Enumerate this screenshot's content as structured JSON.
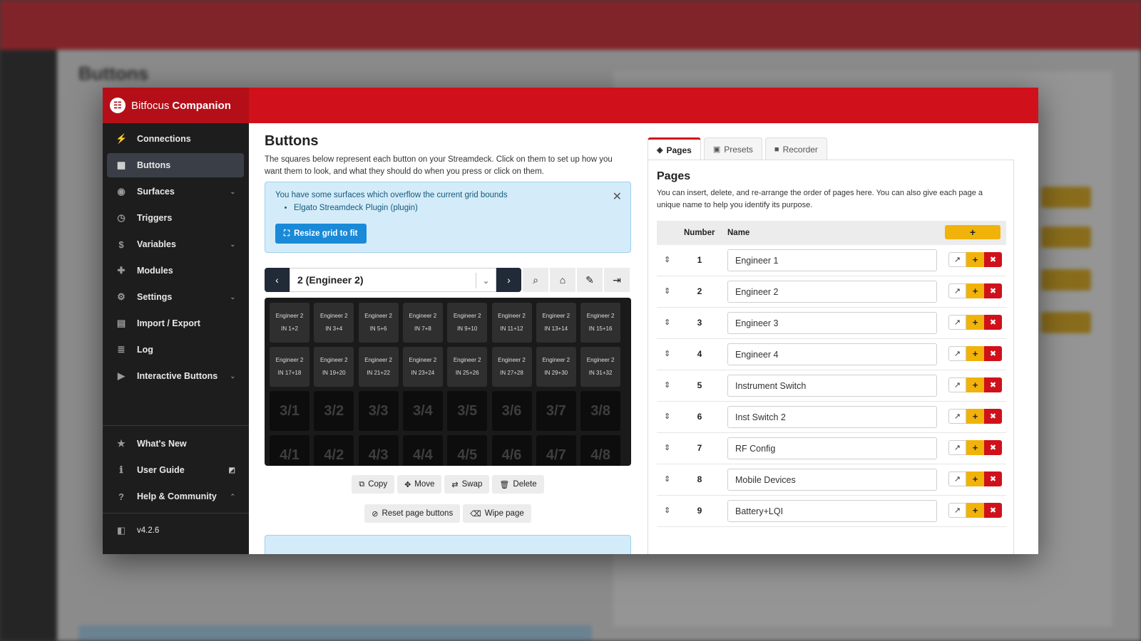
{
  "brand": {
    "logo_glyph": "☷",
    "name_light": "Bitfocus",
    "name_bold": "Companion"
  },
  "colors": {
    "header_red": "#d0111b",
    "sidebar_dark": "#1d1d1d",
    "primary_blue": "#1a8ad8",
    "warning_yellow": "#f1b30a",
    "danger_red": "#d0111b"
  },
  "background": {
    "title": "Buttons"
  },
  "sidebar": {
    "items": [
      {
        "label": "Connections",
        "icon": "plug-icon"
      },
      {
        "label": "Buttons",
        "icon": "grid-icon"
      },
      {
        "label": "Surfaces",
        "icon": "gamepad-icon"
      },
      {
        "label": "Triggers",
        "icon": "clock-icon"
      },
      {
        "label": "Variables",
        "icon": "dollar-icon"
      },
      {
        "label": "Modules",
        "icon": "puzzle-icon"
      },
      {
        "label": "Settings",
        "icon": "gear-icon"
      },
      {
        "label": "Import / Export",
        "icon": "file-import-icon"
      },
      {
        "label": "Log",
        "icon": "log-icon"
      },
      {
        "label": "Interactive Buttons",
        "icon": "play-icon"
      }
    ],
    "bottom": [
      {
        "label": "What's New",
        "icon": "star-icon"
      },
      {
        "label": "User Guide",
        "icon": "info-icon"
      },
      {
        "label": "Help & Community",
        "icon": "help-icon"
      }
    ],
    "version": "v4.2.6"
  },
  "main": {
    "title": "Buttons",
    "description": "The squares below represent each button on your Streamdeck. Click on them to set up how you want them to look, and what they should do when you press or click on them.",
    "alert": {
      "message": "You have some surfaces which overflow the current grid bounds",
      "item": "Elgato Streamdeck Plugin (plugin)",
      "button": "Resize grid to fit"
    },
    "page_select": "2 (Engineer 2)",
    "grid_row1": [
      "Engineer 2",
      "IN 1+2",
      "Engineer 2",
      "IN 3+4",
      "Engineer 2",
      "IN 5+6",
      "Engineer 2",
      "IN 7+8",
      "Engineer 2",
      "IN 9+10",
      "Engineer 2",
      "IN 11+12",
      "Engineer 2",
      "IN 13+14",
      "Engineer 2",
      "IN 15+16"
    ],
    "grid_row2": [
      "Engineer 2",
      "IN 17+18",
      "Engineer 2",
      "IN 19+20",
      "Engineer 2",
      "IN 21+22",
      "Engineer 2",
      "IN 23+24",
      "Engineer 2",
      "IN 25+26",
      "Engineer 2",
      "IN 27+28",
      "Engineer 2",
      "IN 29+30",
      "Engineer 2",
      "IN 31+32"
    ],
    "grid_row3": [
      "3/1",
      "3/2",
      "3/3",
      "3/4",
      "3/5",
      "3/6",
      "3/7",
      "3/8"
    ],
    "grid_row4": [
      "4/1",
      "4/2",
      "4/3",
      "4/4",
      "4/5",
      "4/6",
      "4/7",
      "4/8"
    ],
    "actions": {
      "copy": "Copy",
      "move": "Move",
      "swap": "Swap",
      "delete": "Delete",
      "reset": "Reset page buttons",
      "wipe": "Wipe page"
    }
  },
  "panel": {
    "tabs": {
      "pages": "Pages",
      "presets": "Presets",
      "recorder": "Recorder"
    },
    "title": "Pages",
    "description": "You can insert, delete, and re-arrange the order of pages here. You can also give each page a unique name to help you identify its purpose.",
    "col_number": "Number",
    "col_name": "Name",
    "add_symbol": "+",
    "pages": [
      {
        "number": "1",
        "name": "Engineer 1"
      },
      {
        "number": "2",
        "name": "Engineer 2"
      },
      {
        "number": "3",
        "name": "Engineer 3"
      },
      {
        "number": "4",
        "name": "Engineer 4"
      },
      {
        "number": "5",
        "name": "Instrument Switch"
      },
      {
        "number": "6",
        "name": "Inst Switch 2"
      },
      {
        "number": "7",
        "name": "RF Config"
      },
      {
        "number": "8",
        "name": "Mobile Devices"
      },
      {
        "number": "9",
        "name": "Battery+LQI"
      }
    ]
  }
}
